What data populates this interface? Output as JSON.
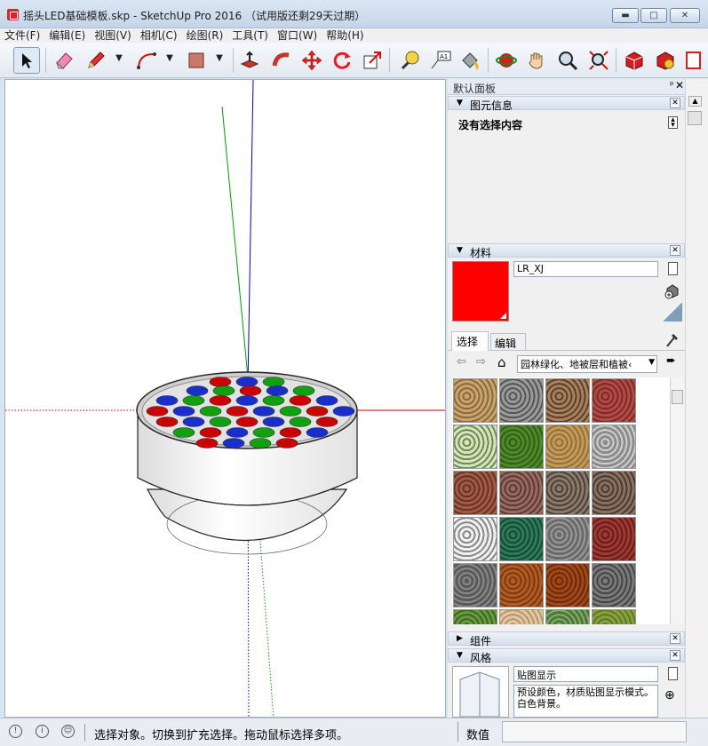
{
  "window": {
    "title": "摇头LED基础模板.skp - SketchUp Pro 2016 （试用版还剩29天过期）",
    "min": "▬",
    "max": "□",
    "close": "✕"
  },
  "menu": [
    "文件(F)",
    "编辑(E)",
    "视图(V)",
    "相机(C)",
    "绘图(R)",
    "工具(T)",
    "窗口(W)",
    "帮助(H)"
  ],
  "tray": {
    "title": "默认面板",
    "entity_info": {
      "title": "图元信息",
      "empty": "没有选择内容"
    },
    "materials": {
      "title": "材料",
      "name": "LR_XJ",
      "color": "#ff0000",
      "tab_select": "选择",
      "tab_edit": "编辑",
      "library": "园林绿化、地被层和植被",
      "library_short": "园林绿化、地被层和植被‹"
    },
    "components": {
      "title": "组件"
    },
    "styles": {
      "title": "风格",
      "name": "贴图显示",
      "desc": "预设颜色，材质贴图显示模式。白色背景。"
    }
  },
  "status": {
    "text": "选择对象。切换到扩充选择。拖动鼠标选择多项。",
    "measure_label": "数值",
    "measure_value": ""
  },
  "colors": {
    "accent": "#d8262a",
    "red_axis": "#d00000",
    "green_axis": "#00a000",
    "blue_axis": "#0000c0"
  }
}
